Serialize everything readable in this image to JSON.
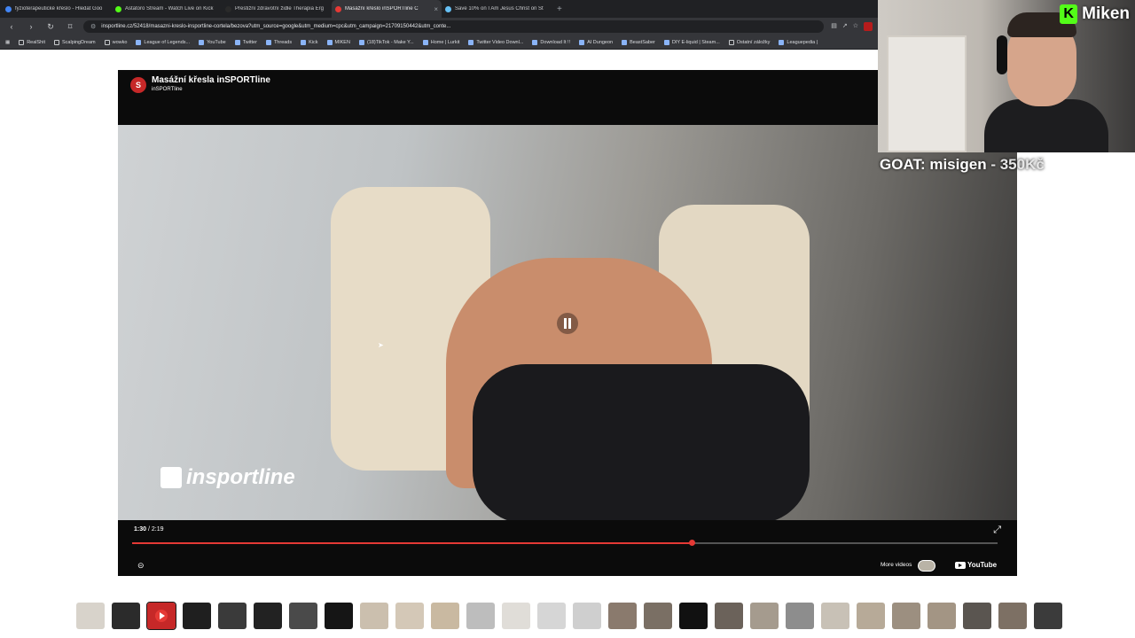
{
  "browser": {
    "tabs": [
      {
        "label": "fyzioterapeutické křeslo - Hledat Goo",
        "favicon_color": "#4285f4",
        "active": false
      },
      {
        "label": "Astatoro Stream - Watch Live on Kick",
        "favicon_color": "#53fc18",
        "active": false
      },
      {
        "label": "Prestižní zdravotní židle Therapia Erg",
        "favicon_color": "#2a2a2a",
        "active": false
      },
      {
        "label": "Masážní křeslo inSPORTline C",
        "favicon_color": "#e53935",
        "active": true
      },
      {
        "label": "Save 10% on I Am Jesus Christ on St",
        "favicon_color": "#66c0f4",
        "active": false
      }
    ],
    "new_tab_label": "+",
    "address": "insportline.cz/52418/masazni-kreslo-insportline-cortela/bezova?utm_source=google&utm_medium=cpc&utm_campaign=21709150442&utm_conte...",
    "bookmarks": [
      {
        "label": "RealShit",
        "folder": true
      },
      {
        "label": "ScalpingDream",
        "folder": true
      },
      {
        "label": "wowko",
        "folder": true
      },
      {
        "label": "League of Legends...",
        "folder": false
      },
      {
        "label": "YouTube",
        "folder": false
      },
      {
        "label": "Twitter",
        "folder": false
      },
      {
        "label": "Threads",
        "folder": false
      },
      {
        "label": "Kick",
        "folder": false
      },
      {
        "label": "MIKEN",
        "folder": false
      },
      {
        "label": "(18)TikTok - Make Y...",
        "folder": false
      },
      {
        "label": "Home | Lurkit",
        "folder": false
      },
      {
        "label": "Twitter Video Downl...",
        "folder": false
      },
      {
        "label": "Download It !!",
        "folder": false
      },
      {
        "label": "AI Dungeon",
        "folder": false
      },
      {
        "label": "BeastSaber",
        "folder": false
      },
      {
        "label": "DIY E-liquid | Steam...",
        "folder": false
      },
      {
        "label": "Ostatní záložky",
        "folder": true
      },
      {
        "label": "Leaguepedia |",
        "folder": false
      }
    ]
  },
  "video": {
    "title": "Masážní křesla inSPORTline",
    "channel": "inSPORTline",
    "watermark": "insportline",
    "current_time": "1:30",
    "duration": "2:19",
    "progress_fraction": 0.647,
    "buffered_fraction": 0.9,
    "more_videos_label": "More videos",
    "youtube_label": "YouTube",
    "state": "playing"
  },
  "overlay": {
    "streamer_name": "Miken",
    "goat_label": "GOAT: misigen",
    "goat_amount": " - 350Kč"
  },
  "thumbnails": [
    {
      "color": "#d8d3cb"
    },
    {
      "color": "#2b2b2b"
    },
    {
      "color": "#c62828",
      "selected": true,
      "video": true
    },
    {
      "color": "#1f1f1f"
    },
    {
      "color": "#3a3a3a"
    },
    {
      "color": "#222222"
    },
    {
      "color": "#4a4a4a"
    },
    {
      "color": "#151515"
    },
    {
      "color": "#cbbfae"
    },
    {
      "color": "#d4c8b7"
    },
    {
      "color": "#c9b9a1"
    },
    {
      "color": "#bdbdbd"
    },
    {
      "color": "#e0ddd8"
    },
    {
      "color": "#d6d6d6"
    },
    {
      "color": "#cfcfcf"
    },
    {
      "color": "#8a7a6d"
    },
    {
      "color": "#7a6f64"
    },
    {
      "color": "#111111"
    },
    {
      "color": "#6b625a"
    },
    {
      "color": "#a59b8e"
    },
    {
      "color": "#8d8d8d"
    },
    {
      "color": "#c8c1b6"
    },
    {
      "color": "#b7aa98"
    },
    {
      "color": "#9c8f80"
    },
    {
      "color": "#a39584"
    },
    {
      "color": "#5a5550"
    },
    {
      "color": "#7d7064"
    },
    {
      "color": "#3b3b3b"
    }
  ]
}
